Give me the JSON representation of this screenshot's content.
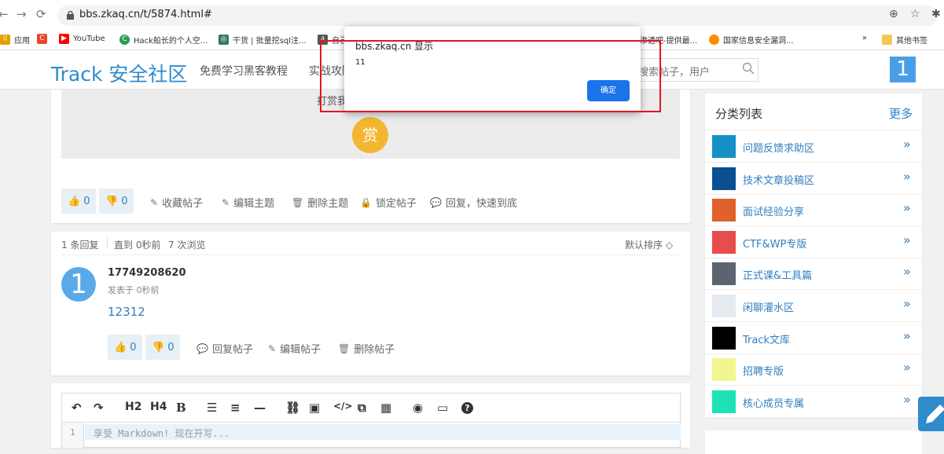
{
  "browser": {
    "url": "bbs.zkaq.cn/t/5874.html#",
    "bookmarks": [
      {
        "label": "应用",
        "color": "#e0a000"
      },
      {
        "label": "",
        "color": "#e8452c"
      },
      {
        "label": "YouTube",
        "color": "#ff0000"
      },
      {
        "label": "Hack船长的个人空...",
        "color": "#2a9d4c"
      },
      {
        "label": "干货 | 批量挖sql注...",
        "color": "#2c7a5a"
      },
      {
        "label": "自己...",
        "color": "#555555"
      },
      {
        "label": "渗透吧-提供最...",
        "color": "#888888"
      },
      {
        "label": "国家信息安全漏洞...",
        "color": "#ff8c00"
      }
    ],
    "more_bookmarks": "»",
    "other_bookmarks": "其他书签"
  },
  "header": {
    "logo": "Track 安全社区",
    "nav": [
      "免费学习黑客教程",
      "实战攻防"
    ],
    "search_placeholder": "搜索帖子，用户",
    "avatar_char": "1"
  },
  "post": {
    "reward_text": "打赏我",
    "reward_badge": "赏",
    "likes": "0",
    "dislikes": "0",
    "actions": [
      "收藏帖子",
      "编辑主题",
      "删除主题",
      "锁定帖子",
      "回复，快速到底"
    ]
  },
  "replies": {
    "count_text": "1 条回复",
    "latest_text": "直到 0秒前",
    "views_text": "7 次浏览",
    "sort_text": "默认排序",
    "items": [
      {
        "avatar_char": "1",
        "user": "17749208620",
        "time": "发表于 0秒前",
        "content": "12312",
        "likes": "0",
        "dislikes": "0",
        "actions": [
          "回复帖子",
          "编辑帖子",
          "删除帖子"
        ]
      }
    ]
  },
  "editor": {
    "tools": [
      "↶",
      "↷",
      "H2",
      "H4",
      "B",
      "☰",
      "≡",
      "—",
      "⛓",
      "▣",
      "</>",
      "⧉",
      "▦",
      "◉",
      "▭",
      "?"
    ],
    "line_number": "1",
    "placeholder": "享受 Markdown! 现在开写..."
  },
  "sidebar": {
    "title": "分类列表",
    "more": "更多",
    "categories": [
      {
        "label": "问题反馈求助区",
        "color": "#1591c7"
      },
      {
        "label": "技术文章投稿区",
        "color": "#0b4f93"
      },
      {
        "label": "面试经验分享",
        "color": "#e0612a"
      },
      {
        "label": "CTF&WP专版",
        "color": "#e84c4c"
      },
      {
        "label": "正式课&工具篇",
        "color": "#5c6470"
      },
      {
        "label": "闲聊灌水区",
        "color": "#e6ebf2"
      },
      {
        "label": "Track文库",
        "color": "#000000"
      },
      {
        "label": "招聘专版",
        "color": "#f3f68f"
      },
      {
        "label": "核心成员专属",
        "color": "#1de3b4"
      }
    ],
    "arrow": "»"
  },
  "dialog": {
    "title": "bbs.zkaq.cn 显示",
    "message": "11",
    "ok": "确定"
  }
}
